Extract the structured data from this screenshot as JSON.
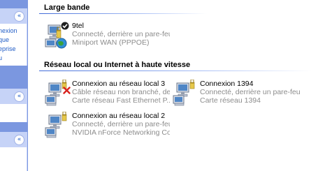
{
  "taskpane": {
    "box1": {
      "lines": [
        "nexion",
        "que",
        "eprise",
        "u"
      ]
    }
  },
  "sections": [
    {
      "title": "Large bande",
      "connections": [
        {
          "name": "9tel",
          "status": "Connecté, derrière un pare-feu",
          "device": "Miniport WAN (PPPOE)",
          "icon": "broadband-connection-icon",
          "badge": "connected-check"
        }
      ]
    },
    {
      "title": "Réseau local ou Internet à haute vitesse",
      "connections": [
        {
          "name": "Connexion au réseau local 3",
          "status": "Câble réseau non branché, de...",
          "device": "Carte réseau Fast Ethernet P...",
          "icon": "lan-connection-icon",
          "badge": "disconnected-x"
        },
        {
          "name": "Connexion 1394",
          "status": "Connecté, derrière un pare-feu",
          "device": "Carte réseau 1394",
          "icon": "lan-connection-icon",
          "badge": "none"
        },
        {
          "name": "Connexion au réseau local 2",
          "status": "Connecté, derrière un pare-feu",
          "device": "NVIDIA nForce Networking Co...",
          "icon": "lan-connection-icon",
          "badge": "none"
        }
      ]
    }
  ],
  "colors": {
    "taskpane_bg": "#7b97e0",
    "taskpane_header": "#c6d3f7",
    "link": "#215dc6",
    "secondary_text": "#8c8c8c",
    "rule": "#3f6ad8",
    "error_x": "#d8221d"
  }
}
